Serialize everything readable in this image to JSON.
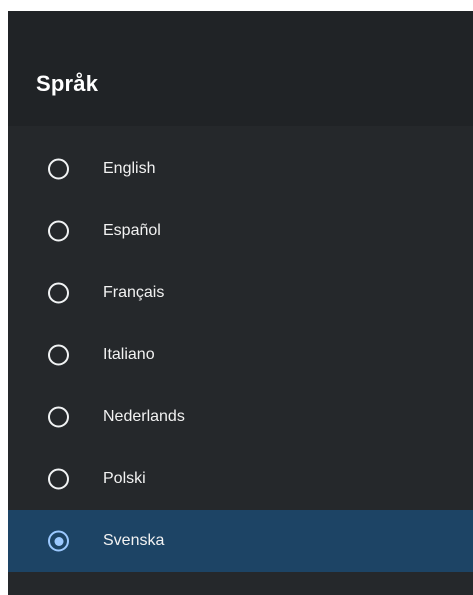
{
  "header": {
    "title": "Språk"
  },
  "language_list": {
    "selected_index": 6,
    "items": [
      {
        "label": "English",
        "selected": false
      },
      {
        "label": "Español",
        "selected": false
      },
      {
        "label": "Français",
        "selected": false
      },
      {
        "label": "Italiano",
        "selected": false
      },
      {
        "label": "Nederlands",
        "selected": false
      },
      {
        "label": "Polski",
        "selected": false
      },
      {
        "label": "Svenska",
        "selected": true
      }
    ]
  },
  "colors": {
    "panel_background": "#25282b",
    "header_background": "#202326",
    "selected_row_background": "#1d4465",
    "radio_selected": "#9cc9ff",
    "text_primary": "#f2f2f2"
  },
  "icons": {
    "radio_unselected": "radio-unchecked-icon",
    "radio_selected": "radio-checked-icon"
  }
}
